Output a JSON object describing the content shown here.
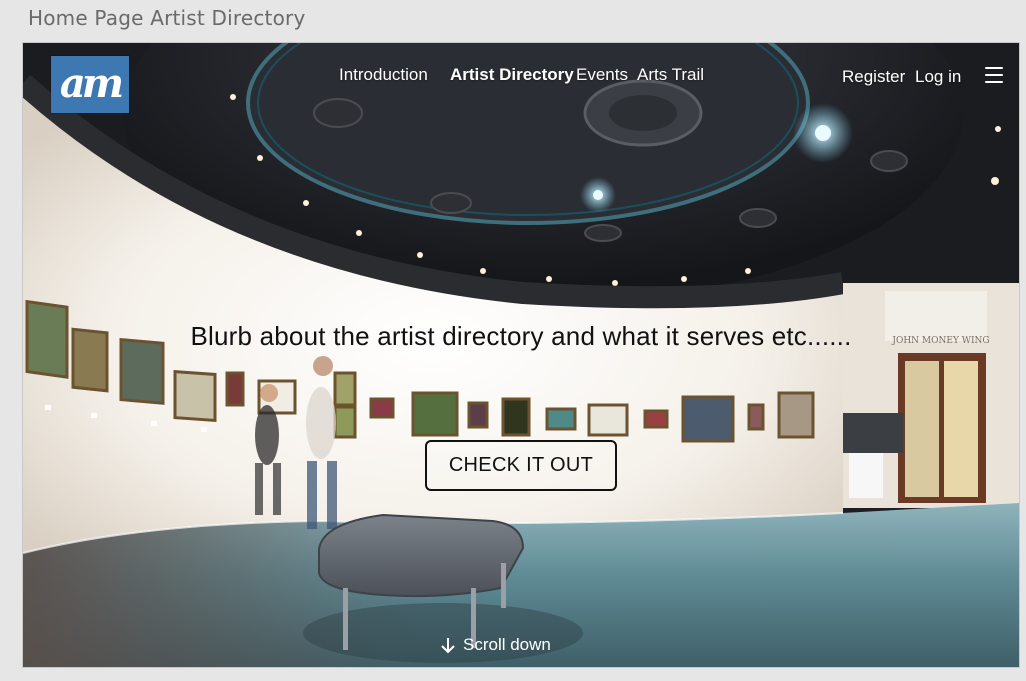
{
  "page": {
    "title": "Home Page Artist Directory"
  },
  "logo": {
    "text": "am"
  },
  "nav": {
    "items": [
      "Introduction",
      "Artist Directory",
      "Events",
      "Arts Trail"
    ],
    "register": "Register",
    "login": "Log in"
  },
  "hero": {
    "blurb": "Blurb about the artist directory and what it serves etc......",
    "cta_label": "CHECK IT OUT",
    "scroll_label": "Scroll down",
    "wing_sign": "JOHN MONEY WING"
  },
  "colors": {
    "logo_bg": "#3d78b2",
    "text_dark": "#111111",
    "nav_text": "#ffffff"
  },
  "icons": {
    "menu": "hamburger-icon",
    "scroll": "arrow-down-icon"
  }
}
